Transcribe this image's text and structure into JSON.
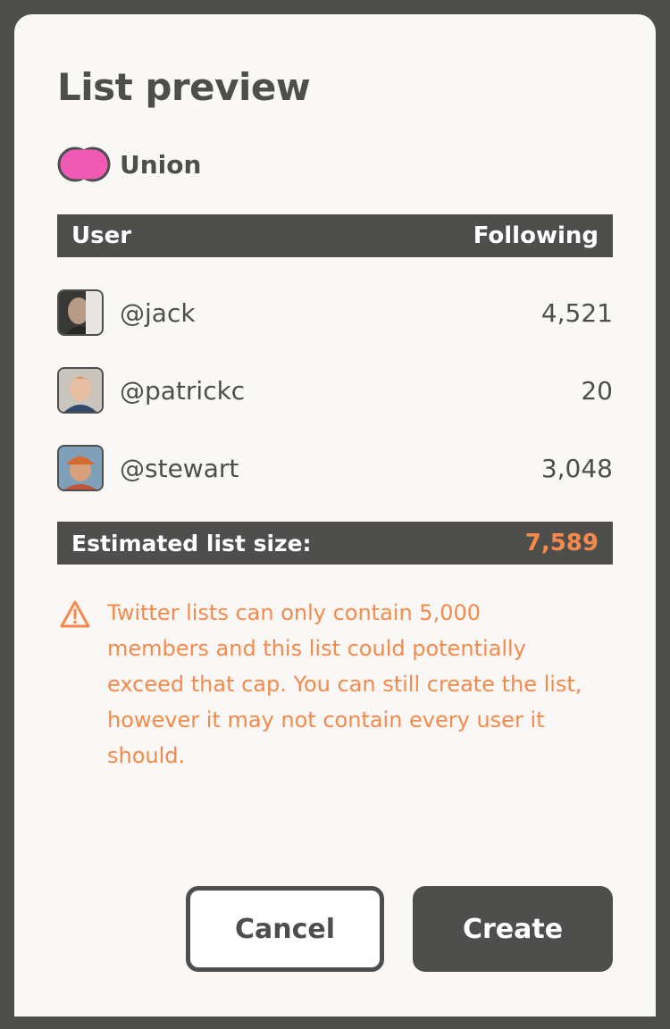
{
  "dialog": {
    "title": "List preview",
    "operation": {
      "icon": "union-icon",
      "label": "Union",
      "color": "#f05ab4"
    },
    "table": {
      "headers": {
        "user": "User",
        "following": "Following"
      },
      "rows": [
        {
          "handle": "@jack",
          "following": "4,521",
          "avatar": "avatar-jack"
        },
        {
          "handle": "@patrickc",
          "following": "20",
          "avatar": "avatar-patrickc"
        },
        {
          "handle": "@stewart",
          "following": "3,048",
          "avatar": "avatar-stewart"
        }
      ]
    },
    "estimate": {
      "label": "Estimated list size:",
      "value": "7,589"
    },
    "warning": {
      "icon": "warning-triangle-icon",
      "text": "Twitter lists can only contain 5,000 members and this list could potentially exceed that cap. You can still create the list, however it may not contain every user it should."
    },
    "buttons": {
      "cancel": "Cancel",
      "create": "Create"
    }
  },
  "colors": {
    "frame": "#4e4e4c",
    "background": "#f9f8f6",
    "accent_orange": "#f7894a",
    "union_pink": "#f05ab4"
  }
}
